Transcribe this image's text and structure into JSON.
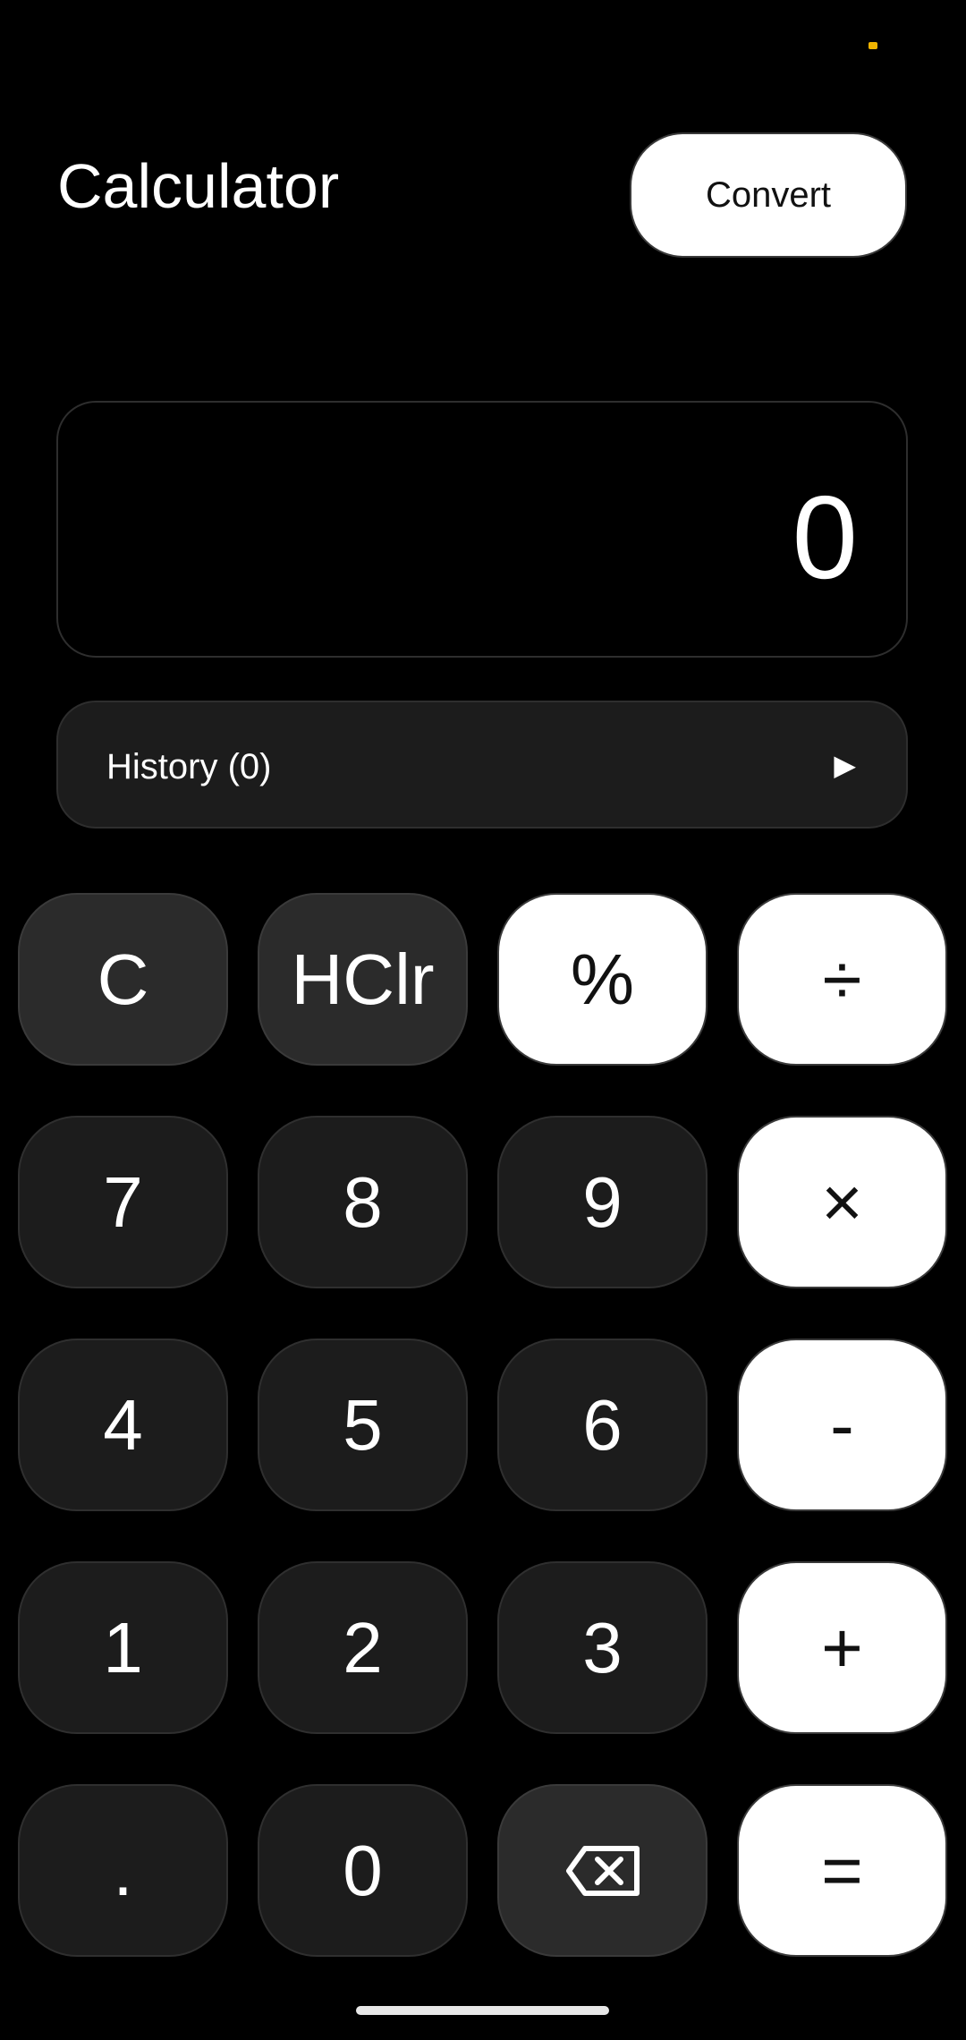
{
  "header": {
    "title": "Calculator",
    "convert_label": "Convert"
  },
  "display": {
    "value": "0"
  },
  "history": {
    "label": "History (0)",
    "toggle_icon": "▶"
  },
  "keypad": {
    "row1": {
      "clear": "C",
      "history_clear": "HClr",
      "percent": "%",
      "divide": "÷"
    },
    "row2": {
      "seven": "7",
      "eight": "8",
      "nine": "9",
      "multiply": "×"
    },
    "row3": {
      "four": "4",
      "five": "5",
      "six": "6",
      "subtract": "-"
    },
    "row4": {
      "one": "1",
      "two": "2",
      "three": "3",
      "add": "+"
    },
    "row5": {
      "decimal": ".",
      "zero": "0",
      "backspace_icon": "backspace-icon",
      "equals": "="
    }
  },
  "colors": {
    "background": "#000000",
    "key_dark": "#1c1c1c",
    "key_mid": "#2b2b2b",
    "key_light": "#ffffff",
    "status_indicator": "#f0b400"
  }
}
